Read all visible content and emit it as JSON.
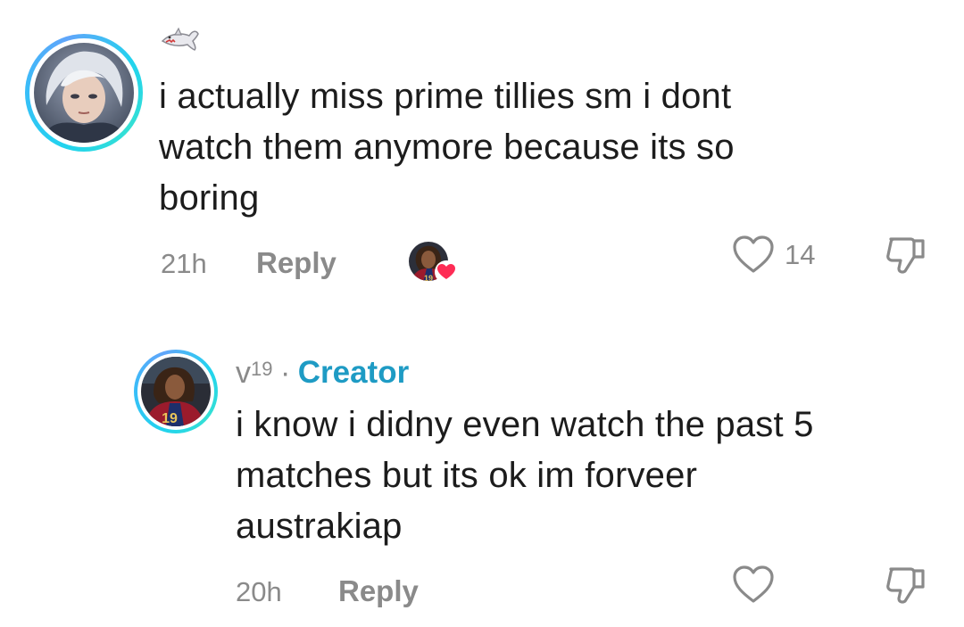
{
  "comments": [
    {
      "user_icon": "shark-icon",
      "text_lines": [
        "i actually miss prime tillies sm i dont",
        "watch them anymore because its so",
        "boring"
      ],
      "time": "21h",
      "reply_label": "Reply",
      "likes": "14",
      "creator_liked": true
    }
  ],
  "reply": {
    "username_base": "v",
    "username_sup": "19",
    "separator": "·",
    "badge": "Creator",
    "text_lines": [
      "i know i didny even watch the past 5",
      "matches but its ok im forveer",
      "austrakiap"
    ],
    "time": "20h",
    "reply_label": "Reply"
  },
  "colors": {
    "ring_accent": "#22d3ee",
    "creator_accent": "#1e9bc4",
    "heart_red": "#fe2c55",
    "meta_gray": "#8a8a8a"
  }
}
